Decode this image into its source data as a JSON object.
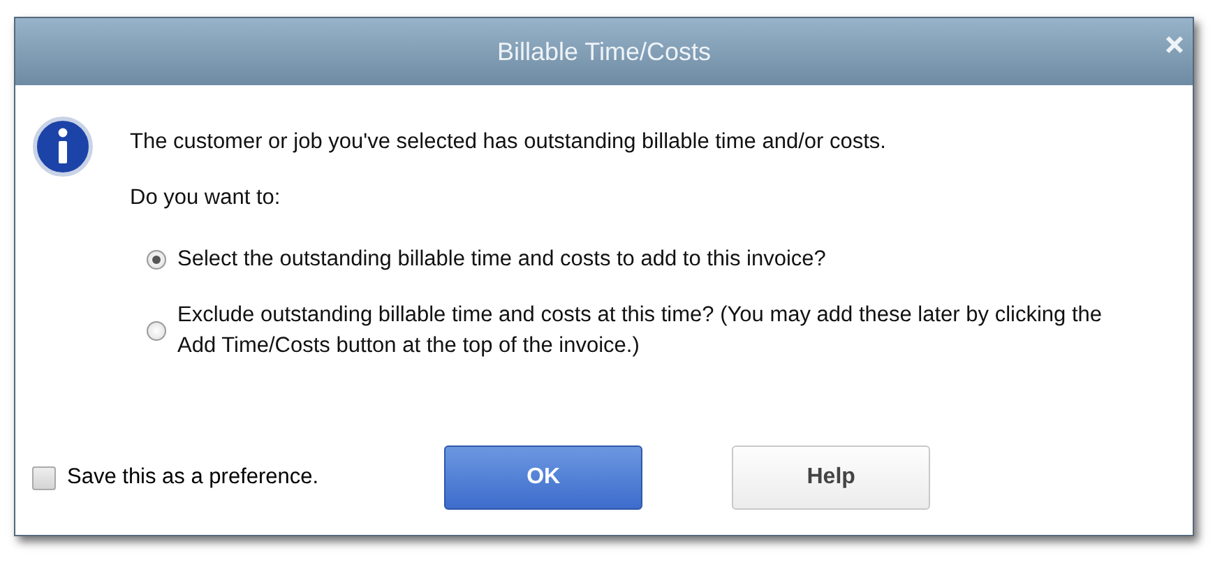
{
  "window": {
    "title": "Billable Time/Costs"
  },
  "message": "The customer or job you've selected has outstanding billable time and/or costs.",
  "question": "Do you want to:",
  "options": [
    {
      "label": "Select the outstanding billable time and costs to add to this invoice?",
      "selected": true
    },
    {
      "label": "Exclude outstanding billable time and costs at this time? (You may add these later by clicking the Add Time/Costs button at the top of the invoice.)",
      "selected": false
    }
  ],
  "preference": {
    "label": "Save this as a preference.",
    "checked": false
  },
  "buttons": [
    {
      "label": "OK",
      "kind": "primary"
    },
    {
      "label": "Help",
      "kind": "secondary"
    }
  ]
}
